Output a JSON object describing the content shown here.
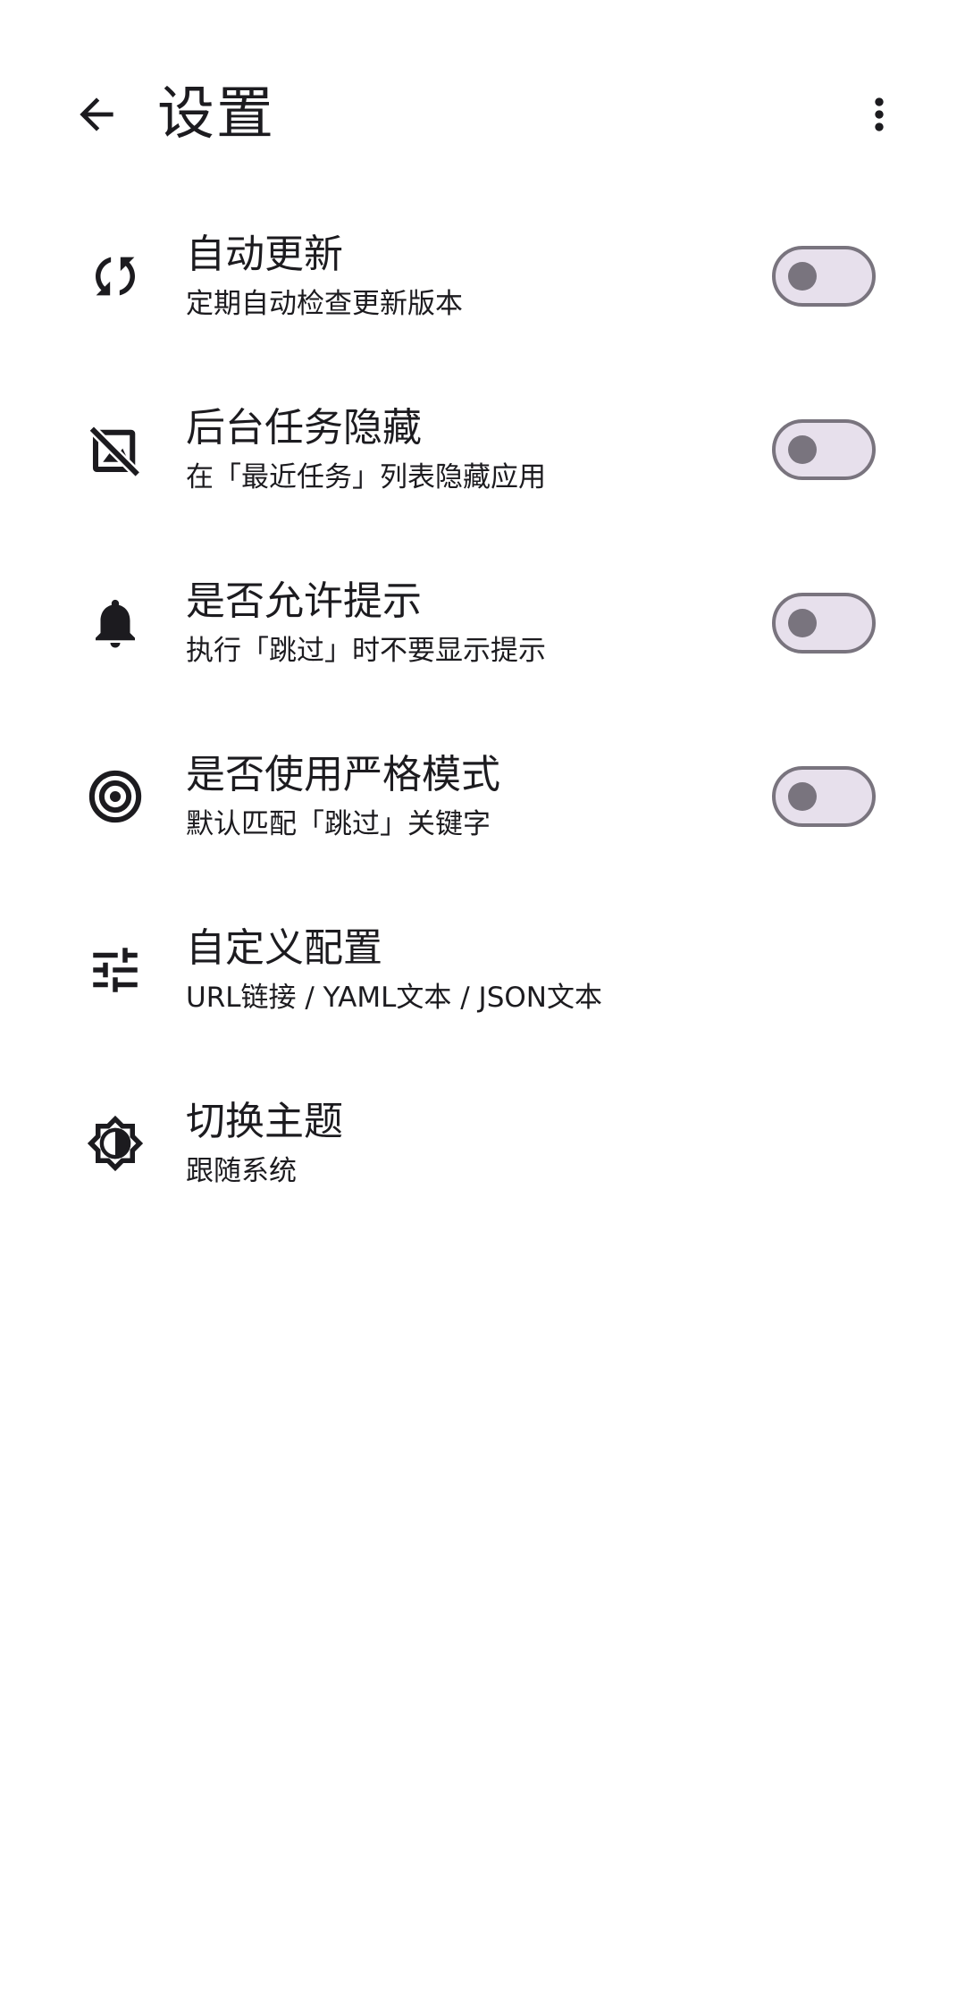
{
  "header": {
    "title": "设置",
    "back_icon": "arrow-back-icon",
    "menu_icon": "more-vert-icon"
  },
  "settings": [
    {
      "icon": "sync-icon",
      "label": "自动更新",
      "sub": "定期自动检查更新版本",
      "toggle": false
    },
    {
      "icon": "hide-image-icon",
      "label": "后台任务隐藏",
      "sub": "在「最近任务」列表隐藏应用",
      "toggle": false
    },
    {
      "icon": "bell-icon",
      "label": "是否允许提示",
      "sub": "执行「跳过」时不要显示提示",
      "toggle": false
    },
    {
      "icon": "target-icon",
      "label": "是否使用严格模式",
      "sub": "默认匹配「跳过」关键字",
      "toggle": false
    },
    {
      "icon": "tune-icon",
      "label": "自定义配置",
      "sub": "URL链接 / YAML文本 / JSON文本"
    },
    {
      "icon": "brightness-icon",
      "label": "切换主题",
      "sub": "跟随系统"
    }
  ],
  "colors": {
    "switch_track": "#e7e0ec",
    "switch_outline": "#79747e",
    "text": "#1c1b1f"
  }
}
